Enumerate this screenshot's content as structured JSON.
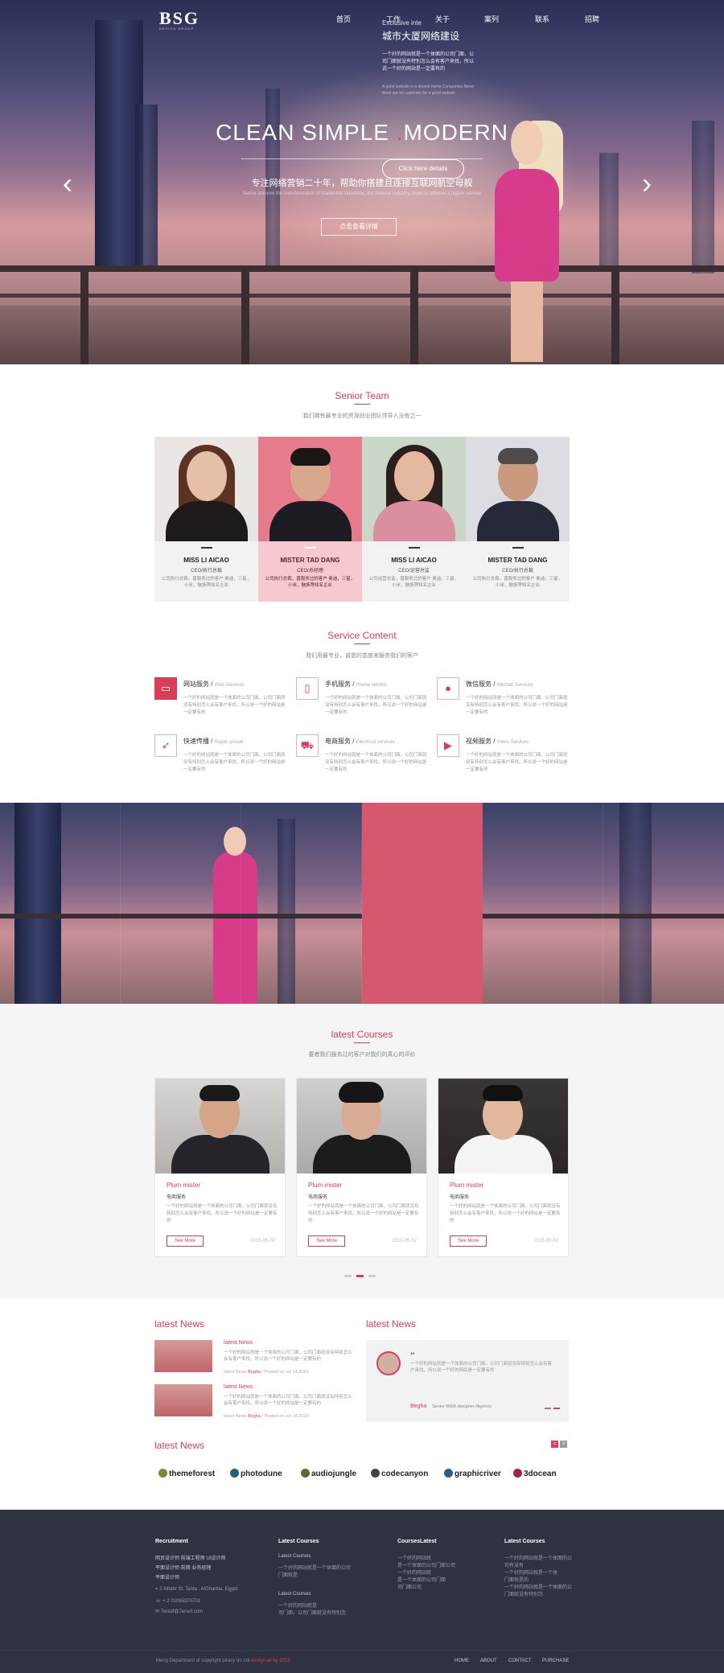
{
  "brand": {
    "logo": "BSG",
    "logo_sub": "DESIGN GROUP"
  },
  "nav": [
    "首页",
    "工作",
    "关于",
    "案列",
    "联系",
    "招聘"
  ],
  "hero": {
    "title_1": "CLEAN",
    "title_2": "SIMPLE",
    "title_3": "MODERN",
    "subtitle": "专注网络营销二十年，帮助你搭建且连接互联网航空母舰",
    "desc": "Senior achieve the transformation of traditional industries, the internet industry, hope to achieve a higher service",
    "button": "点击查看详情",
    "prev_icon": "chevron-left-icon",
    "next_icon": "chevron-right-icon"
  },
  "team": {
    "title": "Senior Team",
    "subtitle": "我们拥有最专业的资深创业团队领导人没有之一",
    "members": [
      {
        "name": "MISS LI AICAO",
        "role": "CEO/执行总裁",
        "desc": "公司执行总裁，曾服务过的客户\n奥迪，三星，小米，魅族等知名企业"
      },
      {
        "name": "MISTER  TAD DANG",
        "role": "CEO/总经理",
        "desc": "公司执行总裁，曾服务过的客户\n奥迪，三星，小米，魅族等知名企业"
      },
      {
        "name": "MISS LI AICAO",
        "role": "CEO/运营总监",
        "desc": "公司运营总监，曾服务过的客户\n奥迪，三星，小米，魅族等知名企业"
      },
      {
        "name": "MISTER  TAD DANG",
        "role": "CEO/执行总裁",
        "desc": "公司执行总裁，曾服务过的客户\n奥迪，三星，小米，魅族等知名企业"
      }
    ]
  },
  "services": {
    "title": "Service Content",
    "subtitle": "我们用最专业，诚恳的态度来服务我们的客户",
    "items": [
      {
        "title": "网站服务",
        "en": "Web Services",
        "icon": "monitor-icon",
        "desc": "一个好的网站就是一个体面的公司门面，公司门面就没有特别怎么会有客户来找，所以说一个好的网站是一定要有的"
      },
      {
        "title": "手机服务",
        "en": "Phone service",
        "icon": "phone-icon",
        "desc": "一个好的网站就是一个体面的公司门面，公司门面就没有特别怎么会有客户来找，所以说一个好的网站是一定要有的"
      },
      {
        "title": "微信服务",
        "en": "Wechat Services",
        "icon": "wechat-icon",
        "desc": "一个好的网站就是一个体面的公司门面，公司门面就没有特别怎么会有客户来找，所以说一个好的网站是一定要有的"
      },
      {
        "title": "快速传播",
        "en": "Rapid spread",
        "icon": "rocket-icon",
        "desc": "一个好的网站就是一个体面的公司门面，公司门面就没有特别怎么会有客户来找，所以说一个好的网站是一定要有的"
      },
      {
        "title": "电商服务",
        "en": "Electrical services",
        "icon": "cart-icon",
        "desc": "一个好的网站就是一个体面的公司门面，公司门面就没有特别怎么会有客户来找，所以说一个好的网站是一定要有的"
      },
      {
        "title": "视频服务",
        "en": "Video Services",
        "icon": "film-icon",
        "desc": "一个好的网站就是一个体面的公司门面，公司门面就没有特别怎么会有客户来找，所以说一个好的网站是一定要有的"
      }
    ]
  },
  "strip": {
    "tag": "Exclusive inte",
    "title": "城市大厦网络建设",
    "text": "一个好的网站就是一个体面的公司门面，公司门面就没有特别怎么会有客户来找，所以说一个好的网站是一定要有的",
    "en": "A good website is a decent home Companies Never there are no customer for a good website",
    "button": "Click here details"
  },
  "courses": {
    "title": "latest Courses",
    "subtitle": "要者我们服务过的客户对我们的真心的评价",
    "items": [
      {
        "name": "Plum  mister",
        "cat": "电商服务",
        "desc": "一个好的网站就是一个体面的公司门面，公司门面就没有特别怎么会有客户来找，所以说一个好的网站是一定要有的",
        "button": "See More",
        "date": "2015-05-02"
      },
      {
        "name": "Plum  mister",
        "cat": "电商服务",
        "desc": "一个好的网站就是一个体面的公司门面，公司门面就没有特别怎么会有客户来找，所以说一个好的网站是一定要有的",
        "button": "See More",
        "date": "2015-05-02"
      },
      {
        "name": "Plum  mister",
        "cat": "电商服务",
        "desc": "一个好的网站就是一个体面的公司门面，公司门面就没有特别怎么会有客户来找，所以说一个好的网站是一定要有的",
        "button": "See More",
        "date": "2015-05-02"
      }
    ]
  },
  "news": {
    "left_title": "latest News",
    "right_title": "latest News",
    "items": [
      {
        "title": "latest News",
        "desc": "一个好的网站就是一个体面的公司门面，公司门面就没有特别怎么会有客户来找，所以说一个好的网站是一定要有的",
        "meta_pre": "latest News",
        "meta_name": "Begha",
        "meta_post": "/ Posted on oct 14,2015"
      },
      {
        "title": "latest News",
        "desc": "一个好的网站就是一个体面的公司门面，公司门面就没有特别怎么会有客户来找，所以说一个好的网站是一定要有的",
        "meta_pre": "latest News",
        "meta_name": "Begha",
        "meta_post": "/ Posted on oct 14,2015"
      }
    ],
    "quote": {
      "mark": "”",
      "text": "一个好的网站就是一个体面的公司门面，公司门面就没有特别怎么会有客户来找，所以说一个好的网站是一定要有的",
      "name": "Begha",
      "role": "Senior WEB designer /Agency"
    }
  },
  "partners": {
    "title": "latest News",
    "brands": [
      "themeforest",
      "photodune",
      "audiojungle",
      "codecanyon",
      "graphicriver",
      "3docean"
    ],
    "prev": "<",
    "next": ">"
  },
  "footer": {
    "cols": [
      {
        "title": "Recruitment",
        "lines": [
          "网页设计师   前端工程师   UI设计师",
          "平面设计师   前期   业务经理",
          "平面设计师"
        ]
      },
      {
        "title": "Latest Courses",
        "lines": [
          "Latest Courses",
          "一个好的网站就是一个体面的公司",
          "门面就是",
          "Latest Courses",
          "一个好的网站就是",
          "司门面，公司门面就没有特别怎"
        ]
      },
      {
        "title": "CoursesLatest",
        "lines": [
          "一个好的网站就",
          "是一个体面的公司门面公司",
          "一个好的网站就",
          "是一个体面的公司门面",
          "司门面公司"
        ]
      },
      {
        "title": "Latest Courses",
        "lines": [
          "一个好的网站就是一个体面的公",
          "司有没有",
          "一个好的网站就是一个体",
          "门面就是的",
          "一个好的网站就是一个体面的公",
          "门面就没有特别怎"
        ]
      }
    ],
    "contact": [
      "2 Alltahr St, Tanta , AlGharbia, Egypt.",
      "+ 2 01065370701",
      "7ersof@7ersof.com"
    ],
    "copyright_pre": "Meng Department of copyright piracy do not",
    "copyright_hl": "design all by 2015",
    "links": [
      "HOME",
      "ABOUT",
      "CONTACT",
      "PURCHASE"
    ]
  },
  "colors": {
    "accent": "#d93d57",
    "footer": "#2f3241"
  }
}
